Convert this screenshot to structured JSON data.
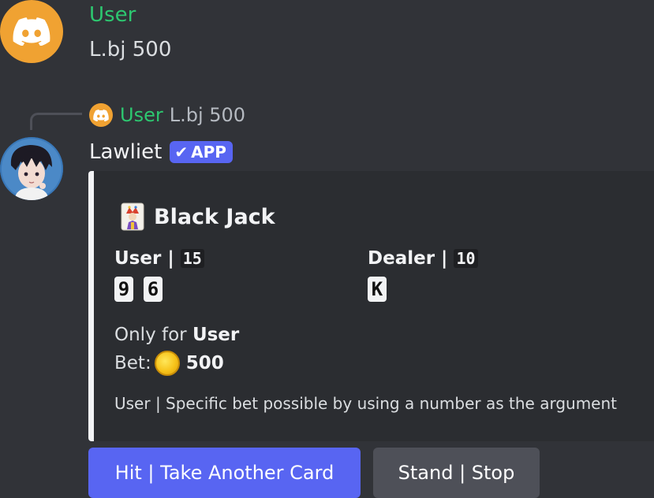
{
  "message1": {
    "author": "User",
    "text": "L.bj 500"
  },
  "reply": {
    "author": "User",
    "text": "L.bj 500"
  },
  "message2": {
    "author": "Lawliet",
    "badge": "APP",
    "badge_icon": "checkmark-icon"
  },
  "embed": {
    "title": "Black Jack",
    "title_icon": "joker-card-icon",
    "user_label": "User |",
    "user_score": "15",
    "user_cards": [
      "9",
      "6"
    ],
    "dealer_label": "Dealer |",
    "dealer_score": "10",
    "dealer_cards": [
      "K"
    ],
    "only_for_prefix": "Only for",
    "only_for_user": "User",
    "bet_label": "Bet:",
    "bet_icon": "gold-coin-icon",
    "bet_value": "500",
    "footer": "User | Specific bet possible by using a number as the argument",
    "accent_color": "#f2f3f5"
  },
  "buttons": {
    "hit": "Hit | Take Another Card",
    "stand": "Stand | Stop"
  },
  "colors": {
    "background": "#313338",
    "embed_bg": "#2b2d31",
    "username_green": "#2dc770",
    "blurple": "#5865f2",
    "secondary_button": "#4e5058"
  }
}
